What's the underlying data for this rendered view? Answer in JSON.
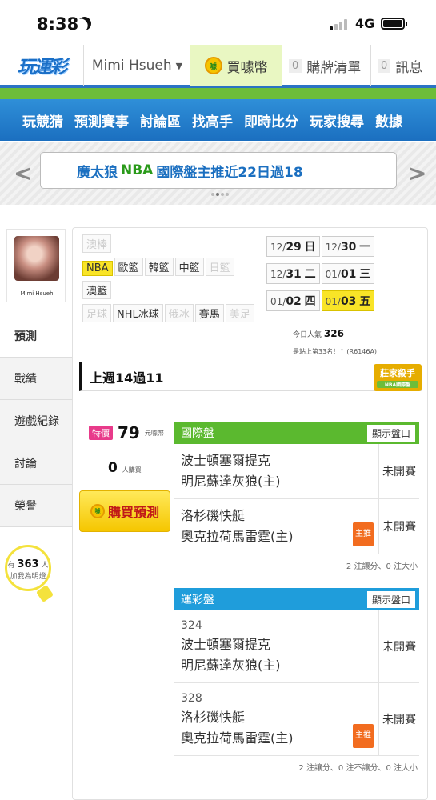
{
  "status": {
    "time": "8:38",
    "network": "4G"
  },
  "header": {
    "logo": "玩運彩",
    "user": "Mimi Hsueh",
    "coins_label": "買噱幣",
    "cart_count": "0",
    "cart_label": "購牌清單",
    "msg_count": "0",
    "msg_label": "訊息"
  },
  "nav": [
    "玩競猜",
    "預測賽事",
    "討論區",
    "找高手",
    "即時比分",
    "玩家搜尋",
    "數據"
  ],
  "banner": {
    "text_a": "廣太狼 ",
    "text_nba": "NBA",
    "text_b": " 國際盤主推近22日過18"
  },
  "profile": {
    "name": "Mimi Hsueh"
  },
  "side": [
    "預測",
    "戰績",
    "遊戲紀錄",
    "討論",
    "榮譽"
  ],
  "lamp": {
    "prefix": "有",
    "count": "363",
    "suffix": "人",
    "caption": "加我為明燈"
  },
  "tags": {
    "row1": [
      {
        "label": "澳棒",
        "state": "off"
      }
    ],
    "row2": [
      {
        "label": "NBA",
        "state": "on"
      },
      {
        "label": "歐籃",
        "state": ""
      },
      {
        "label": "韓籃",
        "state": ""
      },
      {
        "label": "中籃",
        "state": ""
      },
      {
        "label": "日籃",
        "state": "off"
      }
    ],
    "row3": [
      {
        "label": "澳籃",
        "state": ""
      }
    ],
    "row4": [
      {
        "label": "足球",
        "state": "off"
      },
      {
        "label": "NHL冰球",
        "state": ""
      },
      {
        "label": "俄冰",
        "state": "off"
      },
      {
        "label": "賽馬",
        "state": ""
      },
      {
        "label": "美足",
        "state": "off"
      }
    ]
  },
  "dates": [
    {
      "m": "12/",
      "d": "29",
      "w": "日",
      "on": false
    },
    {
      "m": "12/",
      "d": "30",
      "w": "一",
      "on": false
    },
    {
      "m": "12/",
      "d": "31",
      "w": "二",
      "on": false
    },
    {
      "m": "01/",
      "d": "01",
      "w": "三",
      "on": false
    },
    {
      "m": "01/",
      "d": "02",
      "w": "四",
      "on": false
    },
    {
      "m": "01/",
      "d": "03",
      "w": "五",
      "on": true
    }
  ],
  "popularity": {
    "label": "今日人氣",
    "value": "326",
    "rank": "是站上第33名！↑ (R6146A)"
  },
  "week": "上週14過11",
  "expert_badge": {
    "title": "莊家殺手",
    "sub": "NBA國際盤"
  },
  "price": {
    "tag": "特價",
    "value": "79",
    "unit": "元噱幣"
  },
  "buyers": {
    "count": "0",
    "unit": "人購買"
  },
  "buy_button": "購買預測",
  "intl": {
    "title": "國際盤",
    "show": "顯示盤口",
    "games": [
      {
        "no": "",
        "away": "波士頓塞爾提克",
        "home": "明尼蘇達灰狼(主)",
        "status": "未開賽",
        "pick": ""
      },
      {
        "no": "",
        "away": "洛杉磯快艇",
        "home": "奧克拉荷馬雷霆(主)",
        "status": "未開賽",
        "pick": "主推"
      }
    ],
    "note": "2 注讓分、0 注大小"
  },
  "lottery": {
    "title": "運彩盤",
    "show": "顯示盤口",
    "games": [
      {
        "no": "324",
        "away": "波士頓塞爾提克",
        "home": "明尼蘇達灰狼(主)",
        "status": "未開賽",
        "pick": ""
      },
      {
        "no": "328",
        "away": "洛杉磯快艇",
        "home": "奧克拉荷馬雷霆(主)",
        "status": "未開賽",
        "pick": "主推"
      }
    ],
    "note": "2 注讓分、0 注不讓分、0 注大小"
  },
  "colors": {
    "intl": "#5bb92f",
    "lottery": "#1f9ddb",
    "nav": "#1b6fc0",
    "highlight": "#f9e427"
  }
}
